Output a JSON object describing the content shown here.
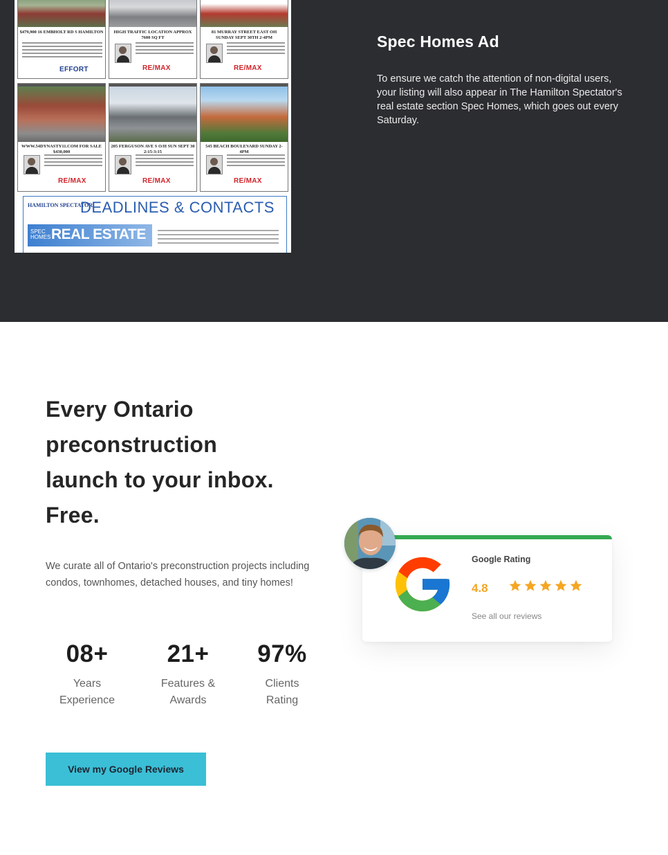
{
  "spec_ad": {
    "title": "Spec Homes Ad",
    "description": "To ensure we catch the attention of non-digital users, your listing will also appear in The Hamilton Spectator's real estate section Spec Homes, which goes out every Saturday."
  },
  "newspaper": {
    "listings": [
      {
        "headline": "$479,900 16 EMBHOLT RD S HAMILTON"
      },
      {
        "headline": "HIGH TRAFFIC LOCATION APPROX 7600 SQ FT"
      },
      {
        "headline": "81 MURRAY STREET EAST OH SUNDAY SEPT 30TH 2-4PM"
      },
      {
        "headline": "WWW.54DYNASTY11.COM FOR SALE $430,000"
      },
      {
        "headline": "205 FERGUSON AVE S O/H SUN SEPT 30 2:15-3:15"
      },
      {
        "headline": "545 BEACH BOULEVARD SUNDAY 2-4PM"
      }
    ],
    "brand_logo": "RE/MAX",
    "masthead": "HAMILTON SPECTATOR",
    "deadlines_title": "DEADLINES & CONTACTS",
    "section_spec": "SPEC HOMES",
    "section_title": "REAL ESTATE"
  },
  "promo": {
    "headline_lines": [
      "Every Ontario",
      "preconstruction",
      "launch to your inbox.",
      "Free."
    ],
    "subtext": "We curate all of Ontario's preconstruction projects including condos, townhomes, detached houses, and tiny homes!"
  },
  "stats": [
    {
      "value": "08+",
      "label_line1": "Years",
      "label_line2": "Experience"
    },
    {
      "value": "21+",
      "label_line1": "Features &",
      "label_line2": "Awards"
    },
    {
      "value": "97%",
      "label_line1": "Clients",
      "label_line2": "Rating"
    }
  ],
  "cta": {
    "label": "View my Google Reviews"
  },
  "google_card": {
    "label": "Google Rating",
    "score": "4.8",
    "stars": 5,
    "link": "See all our reviews",
    "colors": {
      "bar": "#36a852",
      "stars": "#f5a623"
    }
  },
  "colors": {
    "dark_bg": "#2c2d31",
    "cta_bg": "#3bbfd6"
  }
}
